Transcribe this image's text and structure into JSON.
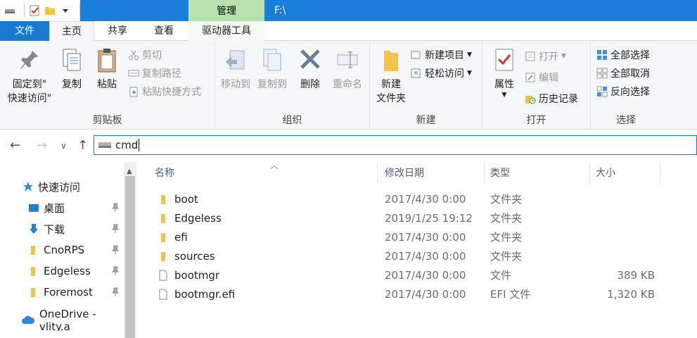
{
  "window": {
    "context_tab": "管理",
    "title": "F:\\"
  },
  "tabs": {
    "file": "文件",
    "home": "主页",
    "share": "共享",
    "view": "查看",
    "drive_tools": "驱动器工具"
  },
  "ribbon": {
    "clipboard": {
      "label": "剪贴板",
      "pin_line1": "固定到\"",
      "pin_line2": "快速访问\"",
      "copy": "复制",
      "paste": "粘贴",
      "cut": "剪切",
      "copy_path": "复制路径",
      "paste_shortcut": "粘贴快捷方式"
    },
    "organize": {
      "label": "组织",
      "move_to": "移动到",
      "copy_to": "复制到",
      "delete": "删除",
      "rename": "重命名"
    },
    "new": {
      "label": "新建",
      "new_folder_line1": "新建",
      "new_folder_line2": "文件夹",
      "new_item": "新建项目",
      "easy_access": "轻松访问"
    },
    "open": {
      "label": "打开",
      "properties": "属性",
      "open": "打开",
      "edit": "编辑",
      "history": "历史记录"
    },
    "select": {
      "label": "选择",
      "select_all": "全部选择",
      "select_none": "全部取消",
      "invert": "反向选择"
    }
  },
  "address": {
    "value": "cmd"
  },
  "nav": {
    "quick_access": "快速访问",
    "items": [
      {
        "label": "桌面"
      },
      {
        "label": "下载"
      },
      {
        "label": "CnoRPS"
      },
      {
        "label": "Edgeless"
      },
      {
        "label": "Foremost"
      }
    ],
    "onedrive": "OneDrive - vlity.a"
  },
  "columns": {
    "name": "名称",
    "date": "修改日期",
    "type": "类型",
    "size": "大小"
  },
  "files": [
    {
      "name": "boot",
      "date": "2017/4/30 0:00",
      "type": "文件夹",
      "size": "",
      "kind": "folder"
    },
    {
      "name": "Edgeless",
      "date": "2019/1/25 19:12",
      "type": "文件夹",
      "size": "",
      "kind": "folder"
    },
    {
      "name": "efi",
      "date": "2017/4/30 0:00",
      "type": "文件夹",
      "size": "",
      "kind": "folder"
    },
    {
      "name": "sources",
      "date": "2017/4/30 0:00",
      "type": "文件夹",
      "size": "",
      "kind": "folder"
    },
    {
      "name": "bootmgr",
      "date": "2017/4/30 0:00",
      "type": "文件",
      "size": "389 KB",
      "kind": "file"
    },
    {
      "name": "bootmgr.efi",
      "date": "2017/4/30 0:00",
      "type": "EFI 文件",
      "size": "1,320 KB",
      "kind": "file"
    }
  ],
  "colors": {
    "accent": "#1979ca",
    "context_tab": "#b6e2ae",
    "folder": "#f4c34b"
  }
}
